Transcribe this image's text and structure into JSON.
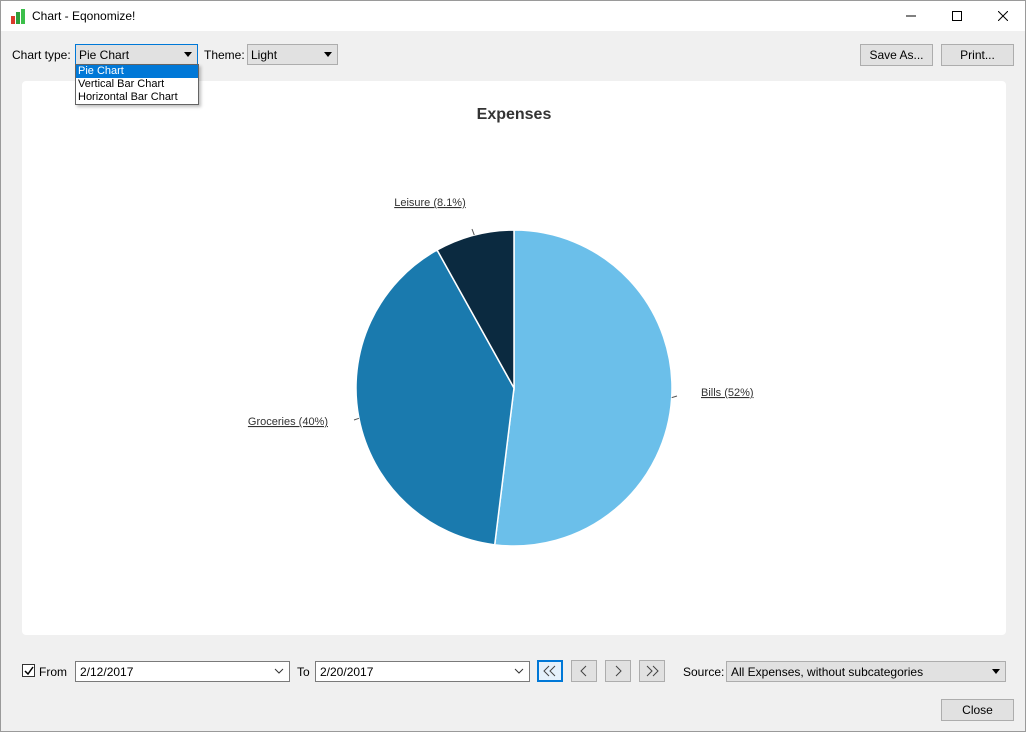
{
  "window": {
    "title": "Chart - Eqonomize!"
  },
  "toolbar": {
    "chart_type_label": "Chart type:",
    "chart_type_value": "Pie Chart",
    "chart_type_options": [
      "Pie Chart",
      "Vertical Bar Chart",
      "Horizontal Bar Chart"
    ],
    "theme_label": "Theme:",
    "theme_value": "Light",
    "save_as_label": "Save As...",
    "print_label": "Print..."
  },
  "chart_data": {
    "type": "pie",
    "title": "Expenses",
    "slices": [
      {
        "label": "Bills (52%)",
        "value": 52,
        "color": "#6bbfea"
      },
      {
        "label": "Groceries (40%)",
        "value": 40,
        "color": "#1a7aae"
      },
      {
        "label": "Leisure (8.1%)",
        "value": 8.1,
        "color": "#0b2a40"
      }
    ]
  },
  "footer": {
    "from_label": "From",
    "from_checked": true,
    "from_date": "2/12/2017",
    "to_label": "To",
    "to_date": "2/20/2017",
    "nav": [
      "<<",
      "<",
      ">",
      ">>"
    ],
    "source_label": "Source:",
    "source_value": "All Expenses, without subcategories",
    "close_label": "Close"
  }
}
